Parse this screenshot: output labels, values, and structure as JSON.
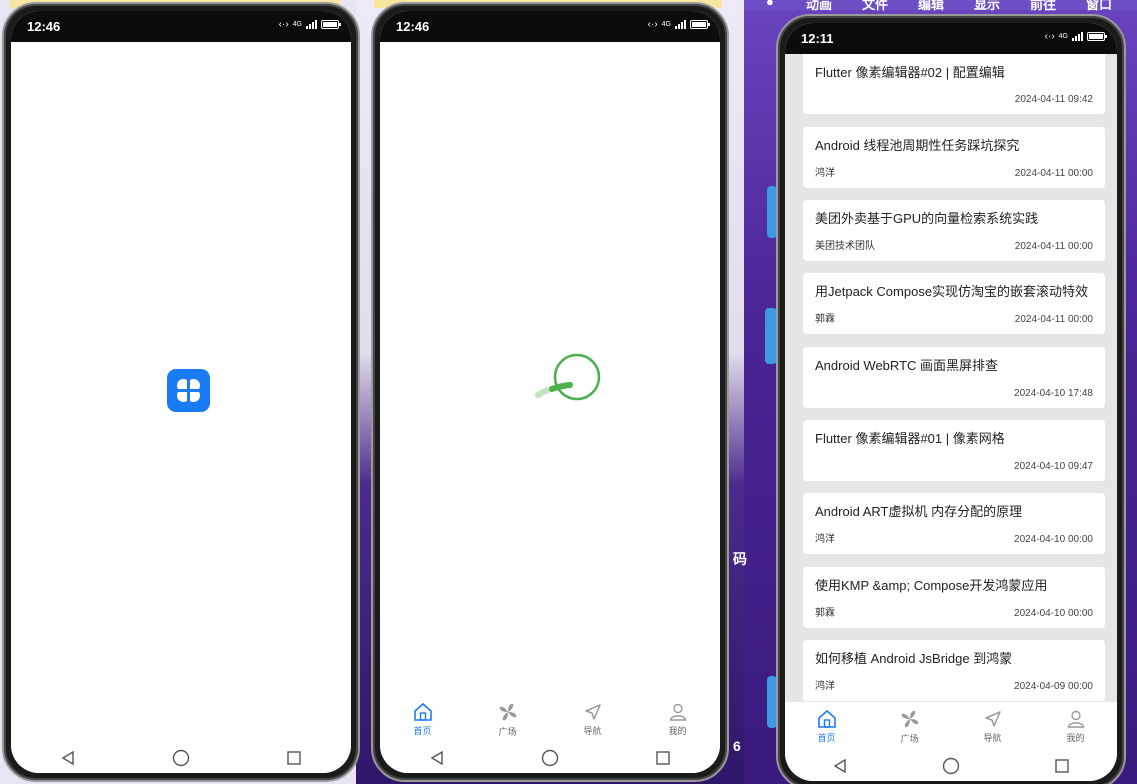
{
  "desktop": {
    "menu": [
      "动画",
      "文件",
      "编辑",
      "显示",
      "前往",
      "窗口"
    ],
    "edge_chars": [
      "码",
      "6"
    ]
  },
  "phone1": {
    "time": "12:46",
    "network": "4G",
    "logo_icon": "four-leaf-app-icon"
  },
  "phone2": {
    "time": "12:46",
    "network": "4G",
    "spinner_icon": "loading-spinner-icon",
    "tabs": [
      {
        "label": "首页",
        "icon": "home-icon",
        "active": true
      },
      {
        "label": "广场",
        "icon": "pinwheel-icon",
        "active": false
      },
      {
        "label": "导航",
        "icon": "navigation-arrow-icon",
        "active": false
      },
      {
        "label": "我的",
        "icon": "person-icon",
        "active": false
      }
    ]
  },
  "phone3": {
    "time": "12:11",
    "network": "4G",
    "articles": [
      {
        "title": "Flutter 像素编辑器#02 | 配置编辑",
        "author": "",
        "date": "2024-04-11 09:42"
      },
      {
        "title": "Android 线程池周期性任务踩坑探究",
        "author": "鸿洋",
        "date": "2024-04-11 00:00"
      },
      {
        "title": "美团外卖基于GPU的向量检索系统实践",
        "author": "美团技术团队",
        "date": "2024-04-11 00:00"
      },
      {
        "title": "用Jetpack Compose实现仿淘宝的嵌套滚动特效",
        "author": "郭霖",
        "date": "2024-04-11 00:00"
      },
      {
        "title": "Android WebRTC 画面黑屏排查",
        "author": "",
        "date": "2024-04-10 17:48"
      },
      {
        "title": "Flutter 像素编辑器#01 | 像素网格",
        "author": "",
        "date": "2024-04-10 09:47"
      },
      {
        "title": "Android ART虚拟机 内存分配的原理",
        "author": "鸿洋",
        "date": "2024-04-10 00:00"
      },
      {
        "title": "使用KMP &amp; Compose开发鸿蒙应用",
        "author": "郭霖",
        "date": "2024-04-10 00:00"
      },
      {
        "title": "如何移植 Android JsBridge 到鸿蒙",
        "author": "鸿洋",
        "date": "2024-04-09 00:00"
      }
    ],
    "tabs": [
      {
        "label": "首页",
        "icon": "home-icon",
        "active": true
      },
      {
        "label": "广场",
        "icon": "pinwheel-icon",
        "active": false
      },
      {
        "label": "导航",
        "icon": "navigation-arrow-icon",
        "active": false
      },
      {
        "label": "我的",
        "icon": "person-icon",
        "active": false
      }
    ]
  },
  "colors": {
    "accent": "#1a7cf4",
    "spinner": "#4cb050",
    "list_background": "#e6e6e6"
  }
}
